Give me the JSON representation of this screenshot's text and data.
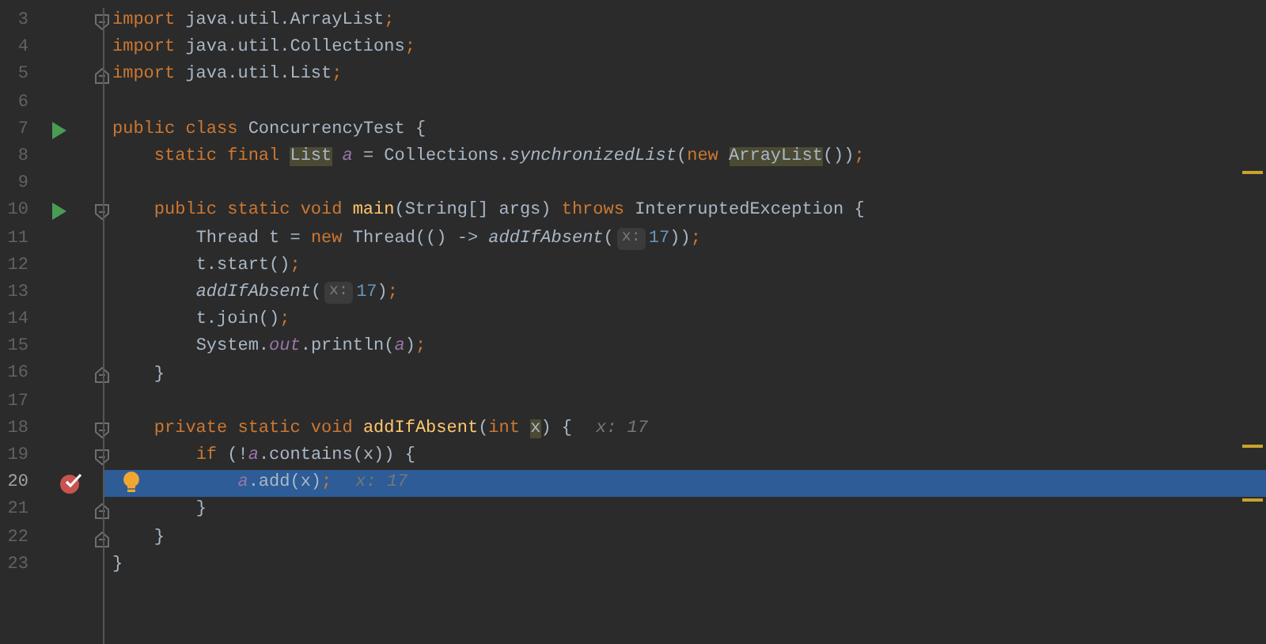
{
  "editor": {
    "lines": [
      {
        "number": "3",
        "run": false,
        "breakpoint": false,
        "bulb": false,
        "fold_start": true,
        "fold_end": false,
        "current": false,
        "tokens": [
          {
            "kind": "keyword",
            "text": "import"
          },
          {
            "kind": "plain",
            "text": " java.util.ArrayList"
          },
          {
            "kind": "keyword",
            "text": ";"
          }
        ]
      },
      {
        "number": "4",
        "run": false,
        "breakpoint": false,
        "bulb": false,
        "fold_start": false,
        "fold_end": false,
        "current": false,
        "tokens": [
          {
            "kind": "keyword",
            "text": "import"
          },
          {
            "kind": "plain",
            "text": " java.util.Collections"
          },
          {
            "kind": "keyword",
            "text": ";"
          }
        ]
      },
      {
        "number": "5",
        "run": false,
        "breakpoint": false,
        "bulb": false,
        "fold_start": false,
        "fold_end": true,
        "current": false,
        "tokens": [
          {
            "kind": "keyword",
            "text": "import"
          },
          {
            "kind": "plain",
            "text": " java.util.List"
          },
          {
            "kind": "keyword",
            "text": ";"
          }
        ]
      },
      {
        "number": "6",
        "run": false,
        "breakpoint": false,
        "bulb": false,
        "fold_start": false,
        "fold_end": false,
        "current": false
      },
      {
        "number": "7",
        "run": true,
        "breakpoint": false,
        "bulb": false,
        "fold_start": false,
        "fold_end": false,
        "current": false,
        "tokens": [
          {
            "kind": "keyword",
            "text": "public class "
          },
          {
            "kind": "plain",
            "text": "ConcurrencyTest {"
          }
        ]
      },
      {
        "number": "8",
        "run": false,
        "breakpoint": false,
        "bulb": false,
        "fold_start": false,
        "fold_end": false,
        "current": false,
        "tokens": [
          {
            "kind": "keyword",
            "text": "    static final "
          },
          {
            "kind": "usage",
            "text": "List"
          },
          {
            "kind": "field",
            "text": " a"
          },
          {
            "kind": "plain",
            "text": " = Collections."
          },
          {
            "kind": "call",
            "text": "synchronizedList"
          },
          {
            "kind": "plain",
            "text": "("
          },
          {
            "kind": "keyword",
            "text": "new "
          },
          {
            "kind": "usage",
            "text": "ArrayList"
          },
          {
            "kind": "plain",
            "text": "())"
          },
          {
            "kind": "keyword",
            "text": ";"
          }
        ]
      },
      {
        "number": "9",
        "run": false,
        "breakpoint": false,
        "bulb": false,
        "fold_start": false,
        "fold_end": false,
        "current": false
      },
      {
        "number": "10",
        "run": true,
        "breakpoint": false,
        "bulb": false,
        "fold_start": true,
        "fold_end": false,
        "current": false,
        "tokens": [
          {
            "kind": "keyword",
            "text": "    public static void "
          },
          {
            "kind": "method",
            "text": "main"
          },
          {
            "kind": "plain",
            "text": "(String[] args) "
          },
          {
            "kind": "keyword",
            "text": "throws "
          },
          {
            "kind": "plain",
            "text": "InterruptedException {"
          }
        ]
      },
      {
        "number": "11",
        "run": false,
        "breakpoint": false,
        "bulb": false,
        "fold_start": false,
        "fold_end": false,
        "current": false,
        "tokens": [
          {
            "kind": "plain",
            "text": "        Thread t = "
          },
          {
            "kind": "keyword",
            "text": "new "
          },
          {
            "kind": "plain",
            "text": "Thread(() -> "
          },
          {
            "kind": "call",
            "text": "addIfAbsent"
          },
          {
            "kind": "plain",
            "text": "("
          },
          {
            "kind": "hint",
            "text": "x:"
          },
          {
            "kind": "number",
            "text": "17"
          },
          {
            "kind": "plain",
            "text": "))"
          },
          {
            "kind": "keyword",
            "text": ";"
          }
        ]
      },
      {
        "number": "12",
        "run": false,
        "breakpoint": false,
        "bulb": false,
        "fold_start": false,
        "fold_end": false,
        "current": false,
        "tokens": [
          {
            "kind": "plain",
            "text": "        t.start()"
          },
          {
            "kind": "keyword",
            "text": ";"
          }
        ]
      },
      {
        "number": "13",
        "run": false,
        "breakpoint": false,
        "bulb": false,
        "fold_start": false,
        "fold_end": false,
        "current": false,
        "tokens": [
          {
            "kind": "call",
            "text": "        addIfAbsent"
          },
          {
            "kind": "plain",
            "text": "("
          },
          {
            "kind": "hint",
            "text": "x:"
          },
          {
            "kind": "number",
            "text": "17"
          },
          {
            "kind": "plain",
            "text": ")"
          },
          {
            "kind": "keyword",
            "text": ";"
          }
        ]
      },
      {
        "number": "14",
        "run": false,
        "breakpoint": false,
        "bulb": false,
        "fold_start": false,
        "fold_end": false,
        "current": false,
        "tokens": [
          {
            "kind": "plain",
            "text": "        t.join()"
          },
          {
            "kind": "keyword",
            "text": ";"
          }
        ]
      },
      {
        "number": "15",
        "run": false,
        "breakpoint": false,
        "bulb": false,
        "fold_start": false,
        "fold_end": false,
        "current": false,
        "tokens": [
          {
            "kind": "plain",
            "text": "        System."
          },
          {
            "kind": "field",
            "text": "out"
          },
          {
            "kind": "plain",
            "text": ".println("
          },
          {
            "kind": "field",
            "text": "a"
          },
          {
            "kind": "plain",
            "text": ")"
          },
          {
            "kind": "keyword",
            "text": ";"
          }
        ]
      },
      {
        "number": "16",
        "run": false,
        "breakpoint": false,
        "bulb": false,
        "fold_start": false,
        "fold_end": true,
        "current": false,
        "tokens": [
          {
            "kind": "plain",
            "text": "    }"
          }
        ]
      },
      {
        "number": "17",
        "run": false,
        "breakpoint": false,
        "bulb": false,
        "fold_start": false,
        "fold_end": false,
        "current": false
      },
      {
        "number": "18",
        "run": false,
        "breakpoint": false,
        "bulb": false,
        "fold_start": true,
        "fold_end": false,
        "current": false,
        "tokens": [
          {
            "kind": "keyword",
            "text": "    private static void "
          },
          {
            "kind": "method",
            "text": "addIfAbsent"
          },
          {
            "kind": "plain",
            "text": "("
          },
          {
            "kind": "keyword",
            "text": "int "
          },
          {
            "kind": "usage",
            "text": "x"
          },
          {
            "kind": "plain",
            "text": ") {"
          },
          {
            "kind": "value",
            "text": "x: 17"
          }
        ]
      },
      {
        "number": "19",
        "run": false,
        "breakpoint": false,
        "bulb": false,
        "fold_start": true,
        "fold_end": false,
        "current": false,
        "tokens": [
          {
            "kind": "keyword",
            "text": "        if "
          },
          {
            "kind": "plain",
            "text": "(!"
          },
          {
            "kind": "field",
            "text": "a"
          },
          {
            "kind": "plain",
            "text": ".contains(x)) {"
          }
        ]
      },
      {
        "number": "20",
        "run": false,
        "breakpoint": true,
        "bulb": true,
        "fold_start": false,
        "fold_end": false,
        "current": true,
        "tokens": [
          {
            "kind": "field",
            "text": "            a"
          },
          {
            "kind": "plain",
            "text": ".add(x)"
          },
          {
            "kind": "keyword",
            "text": ";"
          },
          {
            "kind": "value",
            "text": "x: 17"
          }
        ]
      },
      {
        "number": "21",
        "run": false,
        "breakpoint": false,
        "bulb": false,
        "fold_start": false,
        "fold_end": true,
        "current": false,
        "tokens": [
          {
            "kind": "plain",
            "text": "        }"
          }
        ]
      },
      {
        "number": "22",
        "run": false,
        "breakpoint": false,
        "bulb": false,
        "fold_start": false,
        "fold_end": true,
        "current": false,
        "tokens": [
          {
            "kind": "plain",
            "text": "    }"
          }
        ]
      },
      {
        "number": "23",
        "run": false,
        "breakpoint": false,
        "bulb": false,
        "fold_start": false,
        "fold_end": false,
        "current": false,
        "tokens": [
          {
            "kind": "plain",
            "text": "}"
          }
        ]
      }
    ]
  }
}
